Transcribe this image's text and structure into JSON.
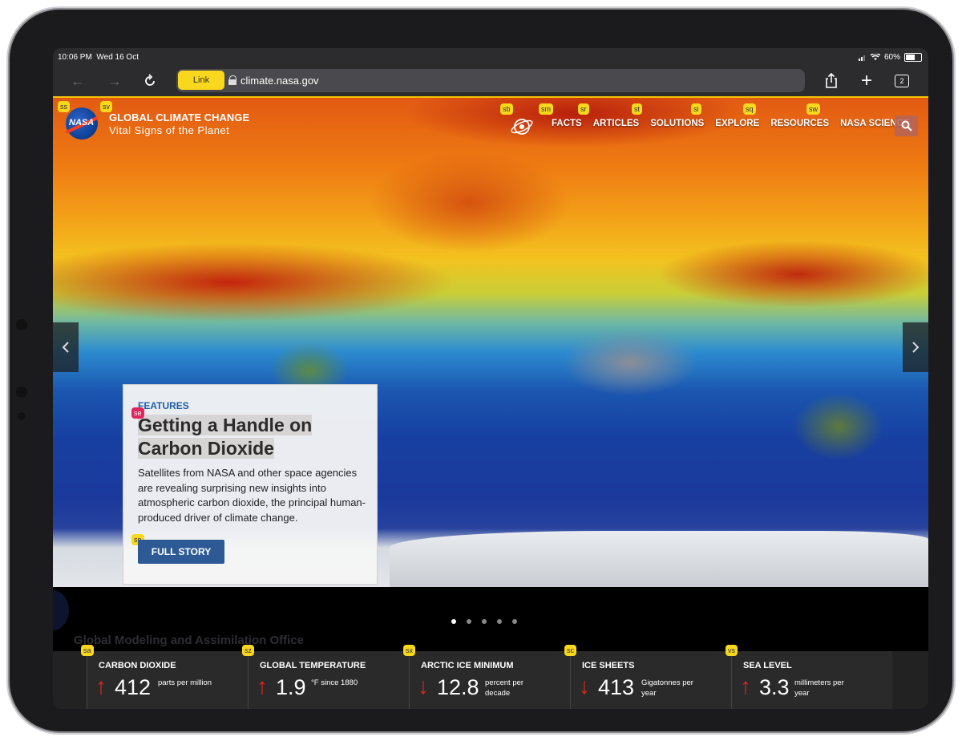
{
  "status_bar": {
    "time": "10:06 PM",
    "date": "Wed 16 Oct",
    "battery": "60%",
    "battery_level": 0.6
  },
  "browser": {
    "link_hint": "Link",
    "url": "climate.nasa.gov",
    "tab_count": "2"
  },
  "site": {
    "logo_text": "NASA",
    "title": "GLOBAL CLIMATE CHANGE",
    "subtitle": "Vital Signs of the Planet",
    "nav": [
      "FACTS",
      "ARTICLES",
      "SOLUTIONS",
      "EXPLORE",
      "RESOURCES",
      "NASA SCIENCE"
    ]
  },
  "hints": {
    "logo": "ss",
    "title": "sv",
    "globe": "sb",
    "facts": "sm",
    "articles": "sr",
    "solutions": "st",
    "explore": "si",
    "resources": "sq",
    "nasa_science": "sw",
    "card_title": "se",
    "full_story": "sp",
    "co2": "sa",
    "temp": "sz",
    "arctic": "sx",
    "ice": "sc",
    "sea": "vs"
  },
  "feature": {
    "kicker": "FEATURES",
    "title": "Getting a Handle on Carbon Dioxide",
    "description": "Satellites from NASA and other space agencies are revealing surprising new insights into atmospheric carbon dioxide, the principal human-produced driver of climate change.",
    "cta": "FULL STORY"
  },
  "video_caption": "Global Modeling and Assimilation Office",
  "carousel": {
    "total": 5,
    "active": 1
  },
  "vitals": [
    {
      "label": "CARBON DIOXIDE",
      "trend": "up",
      "value": "412",
      "unit": "parts per million"
    },
    {
      "label": "GLOBAL TEMPERATURE",
      "trend": "up",
      "value": "1.9",
      "unit": "°F since 1880"
    },
    {
      "label": "ARCTIC ICE MINIMUM",
      "trend": "down",
      "value": "12.8",
      "unit": "percent per decade"
    },
    {
      "label": "ICE SHEETS",
      "trend": "down",
      "value": "413",
      "unit": "Gigatonnes per year"
    },
    {
      "label": "SEA LEVEL",
      "trend": "up",
      "value": "3.3",
      "unit": "millimeters per year"
    }
  ],
  "colors": {
    "hint_yellow": "#f9d71c",
    "hint_pink": "#e0245e",
    "accent_blue": "#2d5a94",
    "trend_red": "#e0281f"
  }
}
